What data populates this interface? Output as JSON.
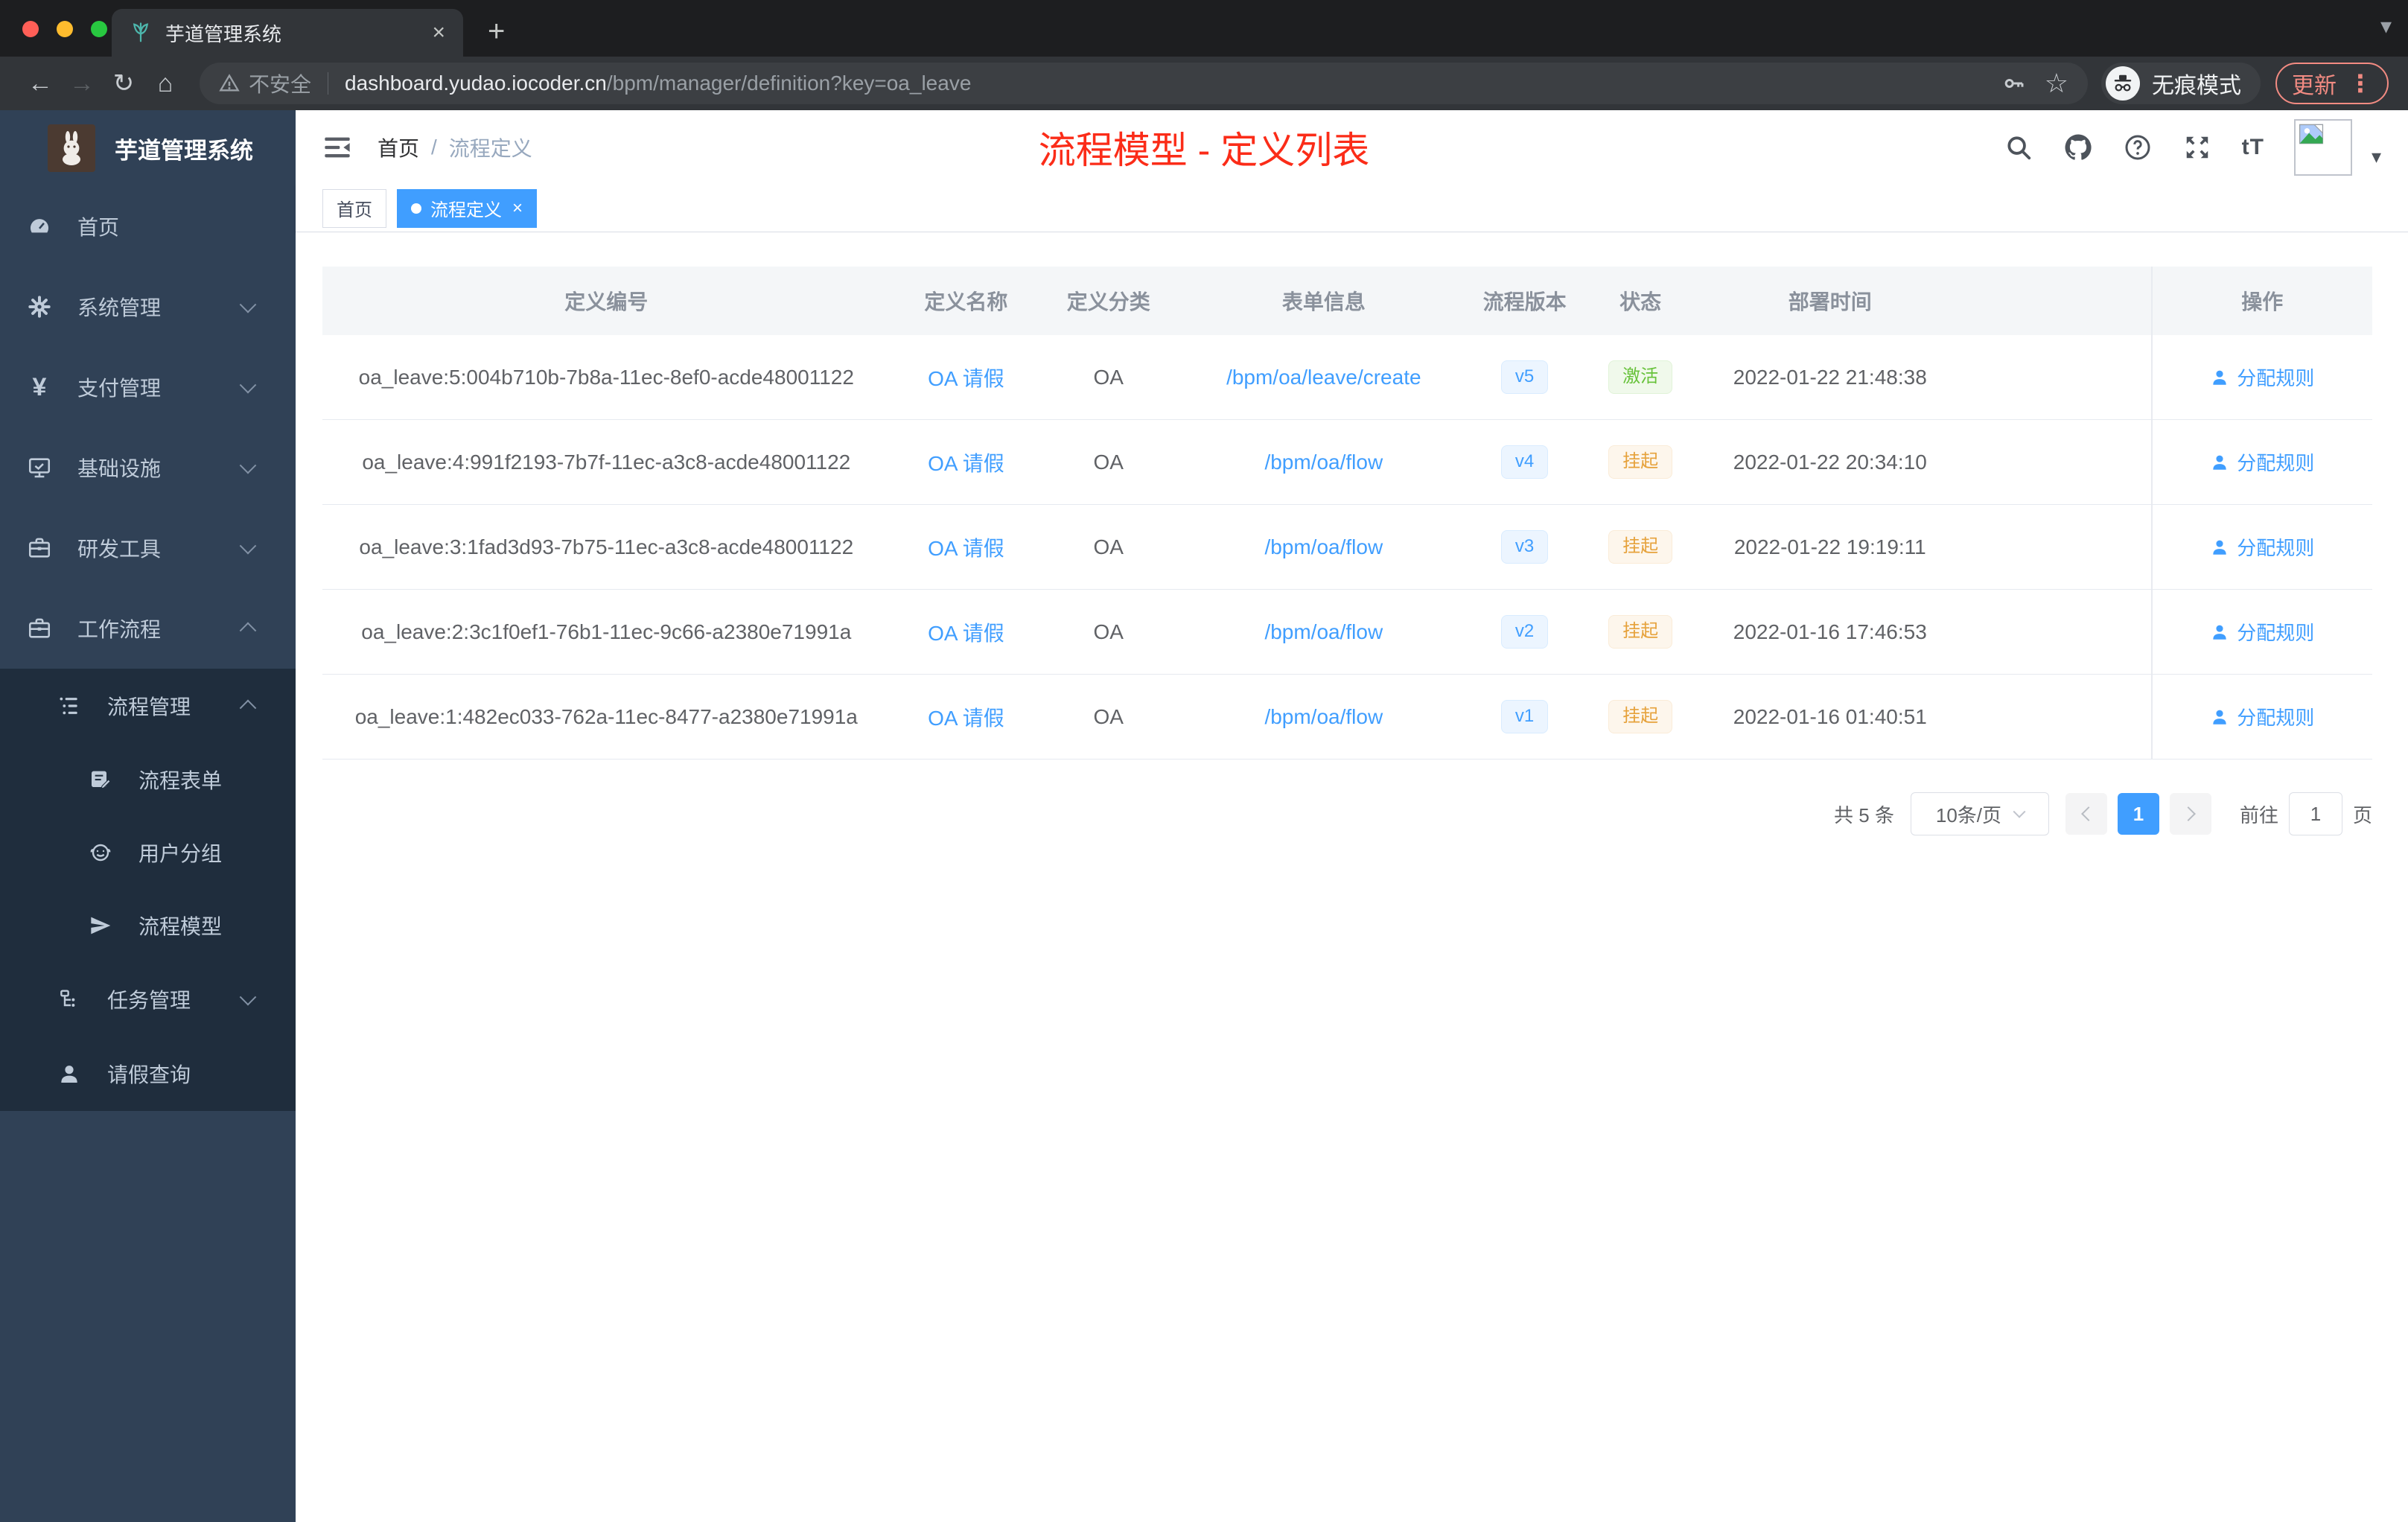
{
  "colors": {
    "accent": "#409eff",
    "annotation_red": "#fb2c18",
    "sidebar_bg": "#304156",
    "submenu_bg": "#1f2d3d",
    "status_active_text": "#67c23a",
    "status_active_bg": "#f0f9eb",
    "status_suspended_text": "#e6a23c",
    "status_suspended_bg": "#fdf6ec",
    "version_badge_bg": "#ecf5ff",
    "update_button": "#f28b82"
  },
  "icons": {
    "tab_favicon": "plant-leaf",
    "browser": [
      "back-arrow",
      "forward-arrow",
      "reload",
      "home",
      "warning-triangle",
      "key",
      "star",
      "incognito-hat-glasses",
      "kebab-dots"
    ],
    "navbar": [
      "hamburger",
      "search-magnifier",
      "github-octocat",
      "help-question",
      "fullscreen-arrows",
      "font-size-tT",
      "broken-image-avatar",
      "caret-down"
    ],
    "sidebar": [
      "dashboard-gauge",
      "gear",
      "yen",
      "monitor",
      "toolbox",
      "briefcase",
      "tree-list",
      "form-edit",
      "face",
      "paper-plane",
      "flow-branch",
      "person"
    ],
    "table_action": "person"
  },
  "browser": {
    "tab_title": "芋道管理系统",
    "tab_close": "×",
    "new_tab": "+",
    "security_label": "不安全",
    "url_host": "dashboard.yudao.iocoder.cn",
    "url_path": "/bpm/manager/definition?key=oa_leave",
    "incognito_label": "无痕模式",
    "update_label": "更新",
    "menu_dots": "⋮"
  },
  "sidebar": {
    "logo_title": "芋道管理系统",
    "menu": [
      {
        "label": "首页"
      },
      {
        "label": "系统管理"
      },
      {
        "label": "支付管理"
      },
      {
        "label": "基础设施"
      },
      {
        "label": "研发工具"
      },
      {
        "label": "工作流程"
      }
    ],
    "submenu": [
      {
        "label": "流程管理"
      },
      {
        "label": "流程表单"
      },
      {
        "label": "用户分组"
      },
      {
        "label": "流程模型"
      },
      {
        "label": "任务管理"
      },
      {
        "label": "请假查询"
      }
    ]
  },
  "navbar": {
    "breadcrumb_home": "首页",
    "breadcrumb_sep": "/",
    "breadcrumb_current": "流程定义",
    "annotation": "流程模型 - 定义列表",
    "font_size_label": "tT"
  },
  "tags": {
    "home": "首页",
    "active": "流程定义",
    "close": "×"
  },
  "table": {
    "columns": [
      "定义编号",
      "定义名称",
      "定义分类",
      "表单信息",
      "流程版本",
      "状态",
      "部署时间",
      "操作"
    ],
    "rows": [
      {
        "id": "oa_leave:5:004b710b-7b8a-11ec-8ef0-acde48001122",
        "name": "OA 请假",
        "category": "OA",
        "form": "/bpm/oa/leave/create",
        "version": "v5",
        "status": "激活",
        "deploy_time": "2022-01-22 21:48:38",
        "action": "分配规则"
      },
      {
        "id": "oa_leave:4:991f2193-7b7f-11ec-a3c8-acde48001122",
        "name": "OA 请假",
        "category": "OA",
        "form": "/bpm/oa/flow",
        "version": "v4",
        "status": "挂起",
        "deploy_time": "2022-01-22 20:34:10",
        "action": "分配规则"
      },
      {
        "id": "oa_leave:3:1fad3d93-7b75-11ec-a3c8-acde48001122",
        "name": "OA 请假",
        "category": "OA",
        "form": "/bpm/oa/flow",
        "version": "v3",
        "status": "挂起",
        "deploy_time": "2022-01-22 19:19:11",
        "action": "分配规则"
      },
      {
        "id": "oa_leave:2:3c1f0ef1-76b1-11ec-9c66-a2380e71991a",
        "name": "OA 请假",
        "category": "OA",
        "form": "/bpm/oa/flow",
        "version": "v2",
        "status": "挂起",
        "deploy_time": "2022-01-16 17:46:53",
        "action": "分配规则"
      },
      {
        "id": "oa_leave:1:482ec033-762a-11ec-8477-a2380e71991a",
        "name": "OA 请假",
        "category": "OA",
        "form": "/bpm/oa/flow",
        "version": "v1",
        "status": "挂起",
        "deploy_time": "2022-01-16 01:40:51",
        "action": "分配规则"
      }
    ]
  },
  "pagination": {
    "total": "共 5 条",
    "page_size": "10条/页",
    "page": "1",
    "goto": "前往",
    "goto_value": "1",
    "unit": "页"
  }
}
